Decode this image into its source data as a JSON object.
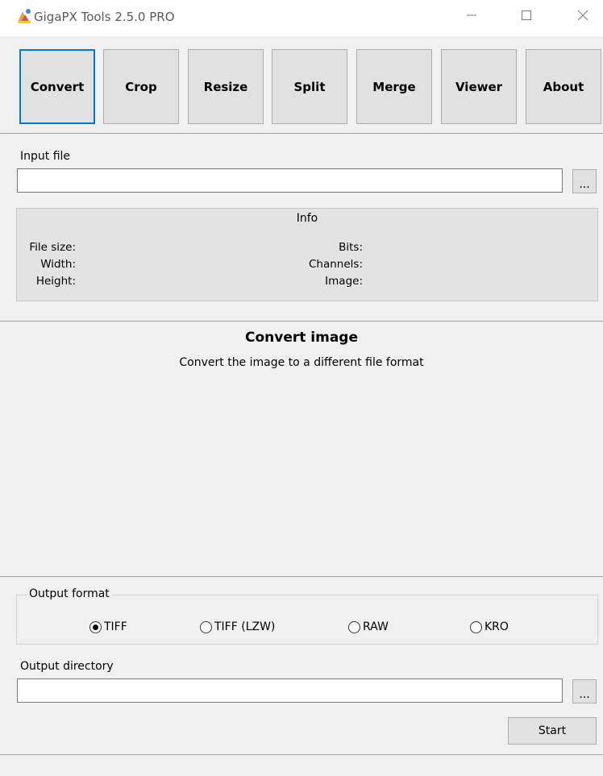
{
  "window": {
    "title": "GigaPX Tools 2.5.0 PRO",
    "icons": [
      "app-icon",
      "minimize-icon",
      "maximize-icon",
      "close-icon"
    ]
  },
  "toolbar": {
    "buttons": [
      "Convert",
      "Crop",
      "Resize",
      "Split",
      "Merge",
      "Viewer",
      "About"
    ],
    "active": "Convert"
  },
  "input": {
    "label": "Input file",
    "value": "",
    "browse_label": "..."
  },
  "info": {
    "title": "Info",
    "file_size_label": "File size:",
    "width_label": "Width:",
    "height_label": "Height:",
    "bits_label": "Bits:",
    "channels_label": "Channels:",
    "image_label": "Image:"
  },
  "main": {
    "title": "Convert image",
    "subtitle": "Convert the image to a different file format"
  },
  "output": {
    "format_label": "Output format",
    "formats": [
      "TIFF",
      "TIFF (LZW)",
      "RAW",
      "KRO"
    ],
    "selected_format": "TIFF",
    "directory_label": "Output directory",
    "directory_value": "",
    "browse_label": "...",
    "start_label": "Start"
  },
  "colors": {
    "accent": "#0078d7",
    "panel_bg": "#f0f0f0",
    "info_bg": "#e3e3e3",
    "button_bg": "#e1e1e1"
  }
}
